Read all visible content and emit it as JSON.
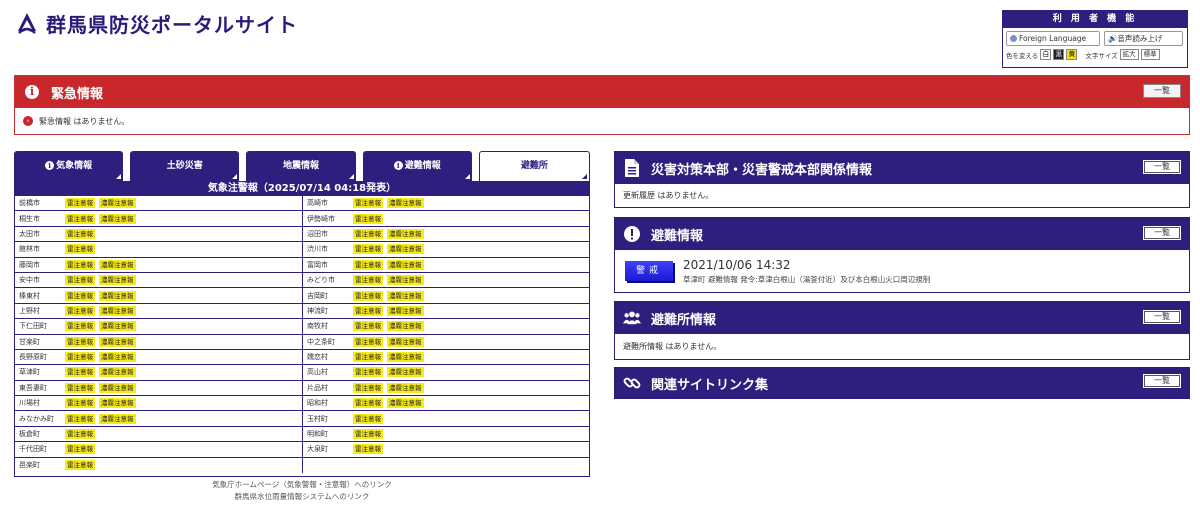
{
  "header": {
    "site_title": "群馬県防災ポータルサイト"
  },
  "user_panel": {
    "title": "利 用 者 機 能",
    "foreign_language": "Foreign Language",
    "voice_read": "音声読み上げ",
    "color_label": "色を変える",
    "color_white": "白",
    "color_black": "黒",
    "color_yellow": "黄",
    "size_label": "文字サイズ",
    "size_large": "拡大",
    "size_standard": "標準"
  },
  "emergency": {
    "title": "緊急情報",
    "list_label": "一覧",
    "message": "緊急情報 はありません。"
  },
  "tabs": [
    {
      "label": "気象情報",
      "has_icon": true
    },
    {
      "label": "土砂災害",
      "has_icon": false
    },
    {
      "label": "地震情報",
      "has_icon": false
    },
    {
      "label": "避難情報",
      "has_icon": true
    },
    {
      "label": "避難所",
      "has_icon": false
    }
  ],
  "warnings": {
    "title": "気象注警報（2025/07/14 04:18発表）",
    "left": [
      {
        "name": "前橋市",
        "badges": [
          "雷注意報",
          "濃霧注意報"
        ]
      },
      {
        "name": "桐生市",
        "badges": [
          "雷注意報",
          "濃霧注意報"
        ]
      },
      {
        "name": "太田市",
        "badges": [
          "雷注意報"
        ]
      },
      {
        "name": "館林市",
        "badges": [
          "雷注意報"
        ]
      },
      {
        "name": "藤岡市",
        "badges": [
          "雷注意報",
          "濃霧注意報"
        ]
      },
      {
        "name": "安中市",
        "badges": [
          "雷注意報",
          "濃霧注意報"
        ]
      },
      {
        "name": "榛東村",
        "badges": [
          "雷注意報",
          "濃霧注意報"
        ]
      },
      {
        "name": "上野村",
        "badges": [
          "雷注意報",
          "濃霧注意報"
        ]
      },
      {
        "name": "下仁田町",
        "badges": [
          "雷注意報",
          "濃霧注意報"
        ]
      },
      {
        "name": "甘楽町",
        "badges": [
          "雷注意報",
          "濃霧注意報"
        ]
      },
      {
        "name": "長野原町",
        "badges": [
          "雷注意報",
          "濃霧注意報"
        ]
      },
      {
        "name": "草津町",
        "badges": [
          "雷注意報",
          "濃霧注意報"
        ]
      },
      {
        "name": "東吾妻町",
        "badges": [
          "雷注意報",
          "濃霧注意報"
        ]
      },
      {
        "name": "川場村",
        "badges": [
          "雷注意報",
          "濃霧注意報"
        ]
      },
      {
        "name": "みなかみ町",
        "badges": [
          "雷注意報",
          "濃霧注意報"
        ]
      },
      {
        "name": "板倉町",
        "badges": [
          "雷注意報"
        ]
      },
      {
        "name": "千代田町",
        "badges": [
          "雷注意報"
        ]
      },
      {
        "name": "邑楽町",
        "badges": [
          "雷注意報"
        ]
      }
    ],
    "right": [
      {
        "name": "高崎市",
        "badges": [
          "雷注意報",
          "濃霧注意報"
        ]
      },
      {
        "name": "伊勢崎市",
        "badges": [
          "雷注意報"
        ]
      },
      {
        "name": "沼田市",
        "badges": [
          "雷注意報",
          "濃霧注意報"
        ]
      },
      {
        "name": "渋川市",
        "badges": [
          "雷注意報",
          "濃霧注意報"
        ]
      },
      {
        "name": "富岡市",
        "badges": [
          "雷注意報",
          "濃霧注意報"
        ]
      },
      {
        "name": "みどり市",
        "badges": [
          "雷注意報",
          "濃霧注意報"
        ]
      },
      {
        "name": "吉岡町",
        "badges": [
          "雷注意報",
          "濃霧注意報"
        ]
      },
      {
        "name": "神流町",
        "badges": [
          "雷注意報",
          "濃霧注意報"
        ]
      },
      {
        "name": "南牧村",
        "badges": [
          "雷注意報",
          "濃霧注意報"
        ]
      },
      {
        "name": "中之条町",
        "badges": [
          "雷注意報",
          "濃霧注意報"
        ]
      },
      {
        "name": "嬬恋村",
        "badges": [
          "雷注意報",
          "濃霧注意報"
        ]
      },
      {
        "name": "高山村",
        "badges": [
          "雷注意報",
          "濃霧注意報"
        ]
      },
      {
        "name": "片品村",
        "badges": [
          "雷注意報",
          "濃霧注意報"
        ]
      },
      {
        "name": "昭和村",
        "badges": [
          "雷注意報",
          "濃霧注意報"
        ]
      },
      {
        "name": "玉村町",
        "badges": [
          "雷注意報"
        ]
      },
      {
        "name": "明和町",
        "badges": [
          "雷注意報"
        ]
      },
      {
        "name": "大泉町",
        "badges": [
          "雷注意報"
        ]
      },
      {
        "name": "",
        "badges": []
      }
    ],
    "link1": "気象庁ホームページ（気象警報・注意報）へのリンク",
    "link2": "群馬県水位雨量情報システムへのリンク"
  },
  "disaster_hq": {
    "title": "災害対策本部・災害警戒本部関係情報",
    "list_label": "一覧",
    "message": "更新履歴 はありません。"
  },
  "evacuation": {
    "title": "避難情報",
    "list_label": "一覧",
    "badge": "警戒",
    "date": "2021/10/06 14:32",
    "desc": "草津町 避難情報 発令:草津白根山（湯釜付近）及び本白根山火口周辺規制"
  },
  "shelter": {
    "title": "避難所情報",
    "list_label": "一覧",
    "message": "避難所情報 はありません。"
  },
  "links": {
    "title": "関連サイトリンク集",
    "list_label": "一覧"
  },
  "colors": {
    "brand_purple": "#2f1e7e",
    "emergency_red": "#c8282b",
    "warning_yellow": "#f6ea1c"
  }
}
